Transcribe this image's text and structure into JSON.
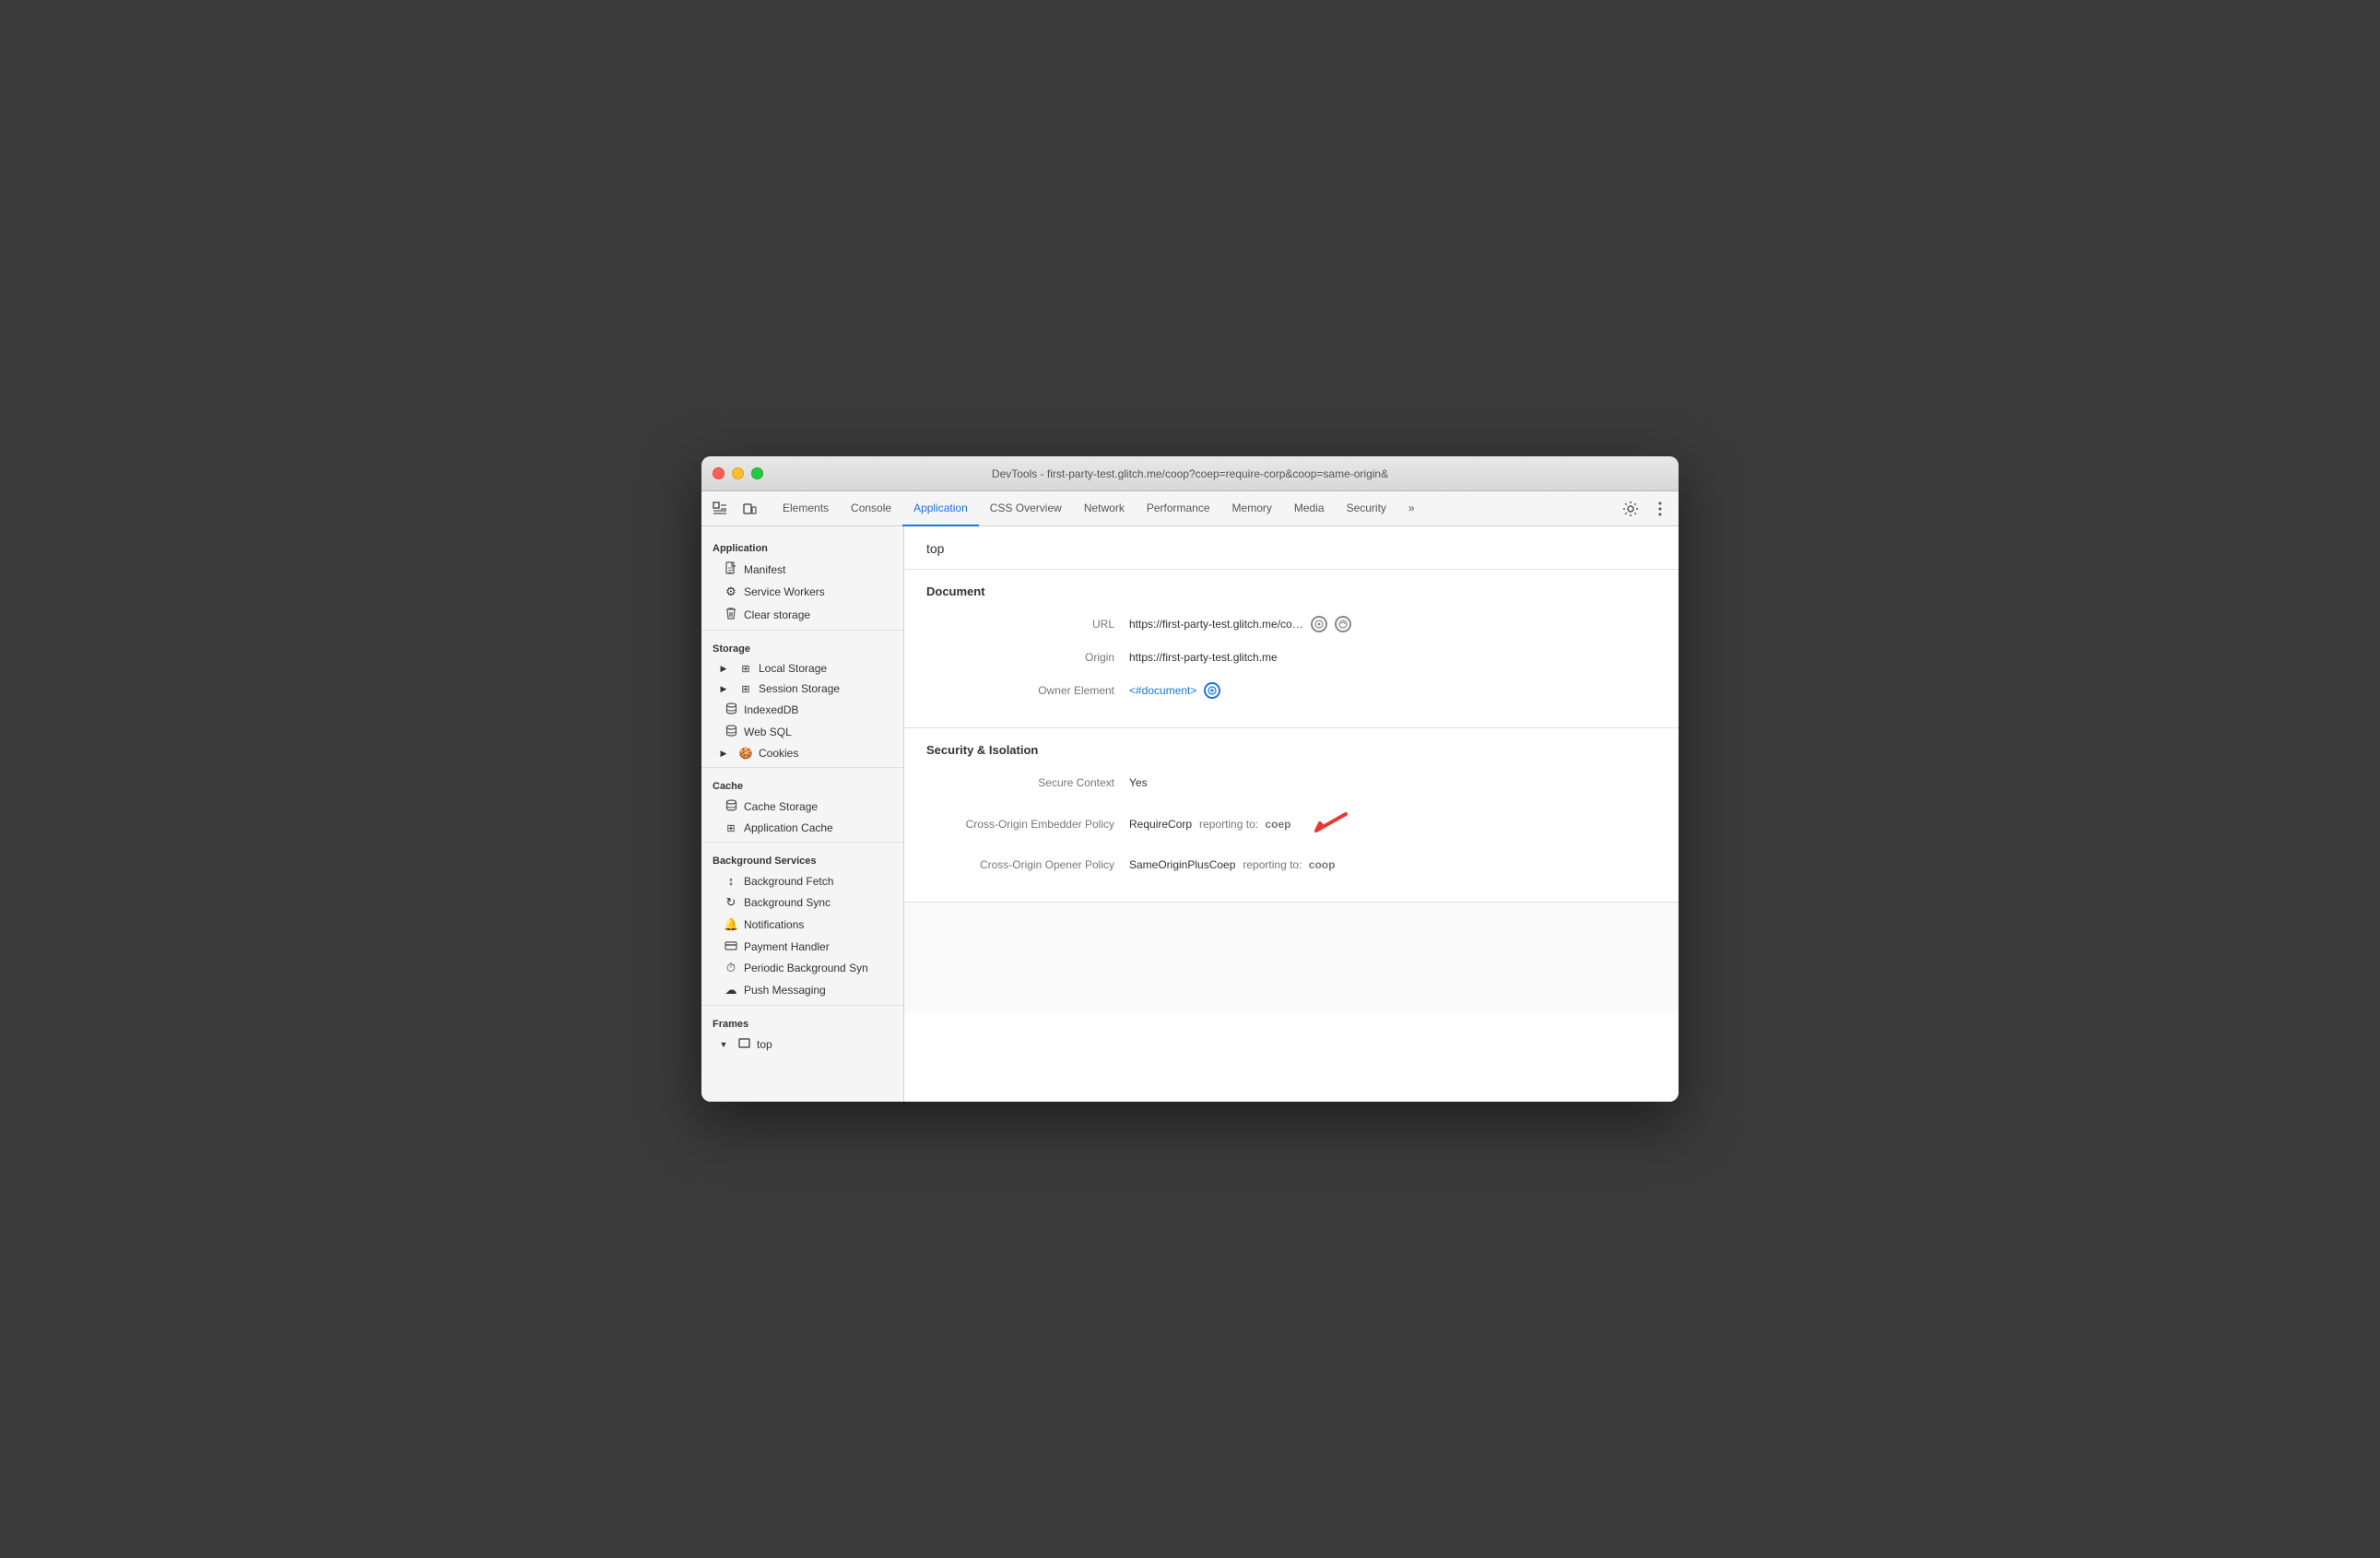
{
  "window": {
    "title": "DevTools - first-party-test.glitch.me/coop?coep=require-corp&coop=same-origin&"
  },
  "tabs": [
    {
      "id": "elements",
      "label": "Elements",
      "active": false
    },
    {
      "id": "console",
      "label": "Console",
      "active": false
    },
    {
      "id": "application",
      "label": "Application",
      "active": true
    },
    {
      "id": "css-overview",
      "label": "CSS Overview",
      "active": false
    },
    {
      "id": "network",
      "label": "Network",
      "active": false
    },
    {
      "id": "performance",
      "label": "Performance",
      "active": false
    },
    {
      "id": "memory",
      "label": "Memory",
      "active": false
    },
    {
      "id": "media",
      "label": "Media",
      "active": false
    },
    {
      "id": "security",
      "label": "Security",
      "active": false
    },
    {
      "id": "more",
      "label": "»",
      "active": false
    }
  ],
  "sidebar": {
    "sections": [
      {
        "id": "application",
        "title": "Application",
        "items": [
          {
            "id": "manifest",
            "label": "Manifest",
            "icon": "📄",
            "type": "file"
          },
          {
            "id": "service-workers",
            "label": "Service Workers",
            "icon": "⚙",
            "type": "gear"
          },
          {
            "id": "clear-storage",
            "label": "Clear storage",
            "icon": "🗑",
            "type": "trash"
          }
        ]
      },
      {
        "id": "storage",
        "title": "Storage",
        "items": [
          {
            "id": "local-storage",
            "label": "Local Storage",
            "icon": "▶ ⊞",
            "type": "expandable"
          },
          {
            "id": "session-storage",
            "label": "Session Storage",
            "icon": "▶ ⊞",
            "type": "expandable"
          },
          {
            "id": "indexeddb",
            "label": "IndexedDB",
            "icon": "🗄",
            "type": "db"
          },
          {
            "id": "web-sql",
            "label": "Web SQL",
            "icon": "🗄",
            "type": "db"
          },
          {
            "id": "cookies",
            "label": "Cookies",
            "icon": "▶ 🍪",
            "type": "expandable-cookie"
          }
        ]
      },
      {
        "id": "cache",
        "title": "Cache",
        "items": [
          {
            "id": "cache-storage",
            "label": "Cache Storage",
            "icon": "🗄",
            "type": "db"
          },
          {
            "id": "app-cache",
            "label": "Application Cache",
            "icon": "⊞",
            "type": "grid"
          }
        ]
      },
      {
        "id": "background-services",
        "title": "Background Services",
        "items": [
          {
            "id": "bg-fetch",
            "label": "Background Fetch",
            "icon": "↕",
            "type": "arrows"
          },
          {
            "id": "bg-sync",
            "label": "Background Sync",
            "icon": "↻",
            "type": "sync"
          },
          {
            "id": "notifications",
            "label": "Notifications",
            "icon": "🔔",
            "type": "bell"
          },
          {
            "id": "payment-handler",
            "label": "Payment Handler",
            "icon": "💳",
            "type": "card"
          },
          {
            "id": "periodic-bg-sync",
            "label": "Periodic Background Syn",
            "icon": "⏱",
            "type": "clock"
          },
          {
            "id": "push-messaging",
            "label": "Push Messaging",
            "icon": "☁",
            "type": "cloud"
          }
        ]
      },
      {
        "id": "frames",
        "title": "Frames",
        "items": [
          {
            "id": "top",
            "label": "top",
            "icon": "▼ □",
            "type": "frame-expanded"
          }
        ]
      }
    ]
  },
  "content": {
    "page_title": "top",
    "sections": [
      {
        "id": "document",
        "title": "Document",
        "fields": [
          {
            "label": "URL",
            "value": "https://first-party-test.glitch.me/co…",
            "has_icons": true,
            "icon_type": "circle-reload"
          },
          {
            "label": "Origin",
            "value": "https://first-party-test.glitch.me",
            "has_icons": false
          },
          {
            "label": "Owner Element",
            "value": "<#document>",
            "value_type": "link",
            "has_circle_icon": true
          }
        ]
      },
      {
        "id": "security",
        "title": "Security & Isolation",
        "fields": [
          {
            "label": "Secure Context",
            "value": "Yes",
            "has_icons": false
          },
          {
            "label": "Cross-Origin Embedder Policy",
            "value": "RequireCorp",
            "reporting": "reporting to:",
            "reporting_value": "coep",
            "has_red_arrow": true
          },
          {
            "label": "Cross-Origin Opener Policy",
            "value": "SameOriginPlusCoep",
            "reporting": "reporting to:",
            "reporting_value": "coop",
            "has_red_arrow": false
          }
        ]
      }
    ]
  }
}
